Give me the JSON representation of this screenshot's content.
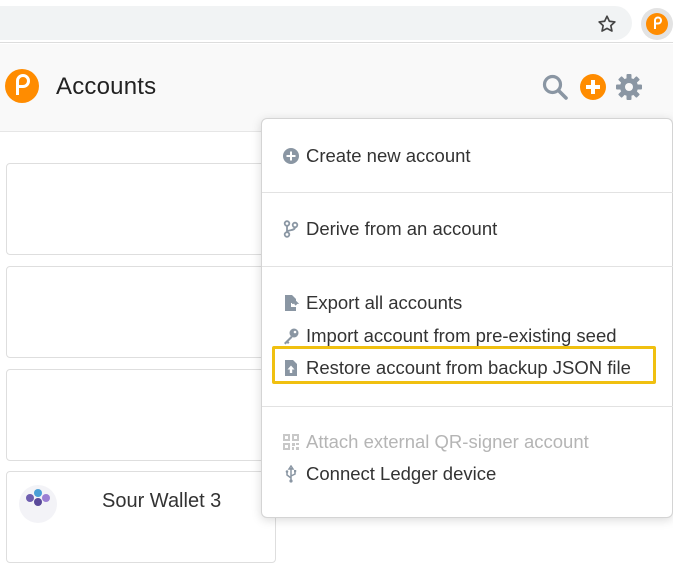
{
  "app": {
    "title": "Accounts"
  },
  "browser": {
    "icons": [
      "star-icon",
      "polkadot-extension-icon"
    ]
  },
  "header": {
    "icons": [
      "search-icon",
      "add-icon",
      "settings-icon"
    ],
    "colors": {
      "accent": "#ff8c00",
      "icon_grey": "#8a96a3"
    }
  },
  "accounts_list": {
    "partial_name": "Sour Wallet 3"
  },
  "menu": {
    "groups": [
      {
        "items": [
          {
            "label": "Create new account",
            "icon": "plus-circle-icon"
          }
        ]
      },
      {
        "items": [
          {
            "label": "Derive from an account",
            "icon": "branch-icon"
          }
        ]
      },
      {
        "items": [
          {
            "label": "Export all accounts",
            "icon": "export-file-icon"
          },
          {
            "label": "Import account from pre-existing seed",
            "icon": "key-icon"
          },
          {
            "label": "Restore account from backup JSON file",
            "icon": "file-upload-icon",
            "highlighted": true
          }
        ]
      },
      {
        "items": [
          {
            "label": "Attach external QR-signer account",
            "icon": "qr-code-icon",
            "disabled": true
          },
          {
            "label": "Connect Ledger device",
            "icon": "usb-icon"
          }
        ]
      }
    ],
    "highlight_color": "#f0c010"
  }
}
